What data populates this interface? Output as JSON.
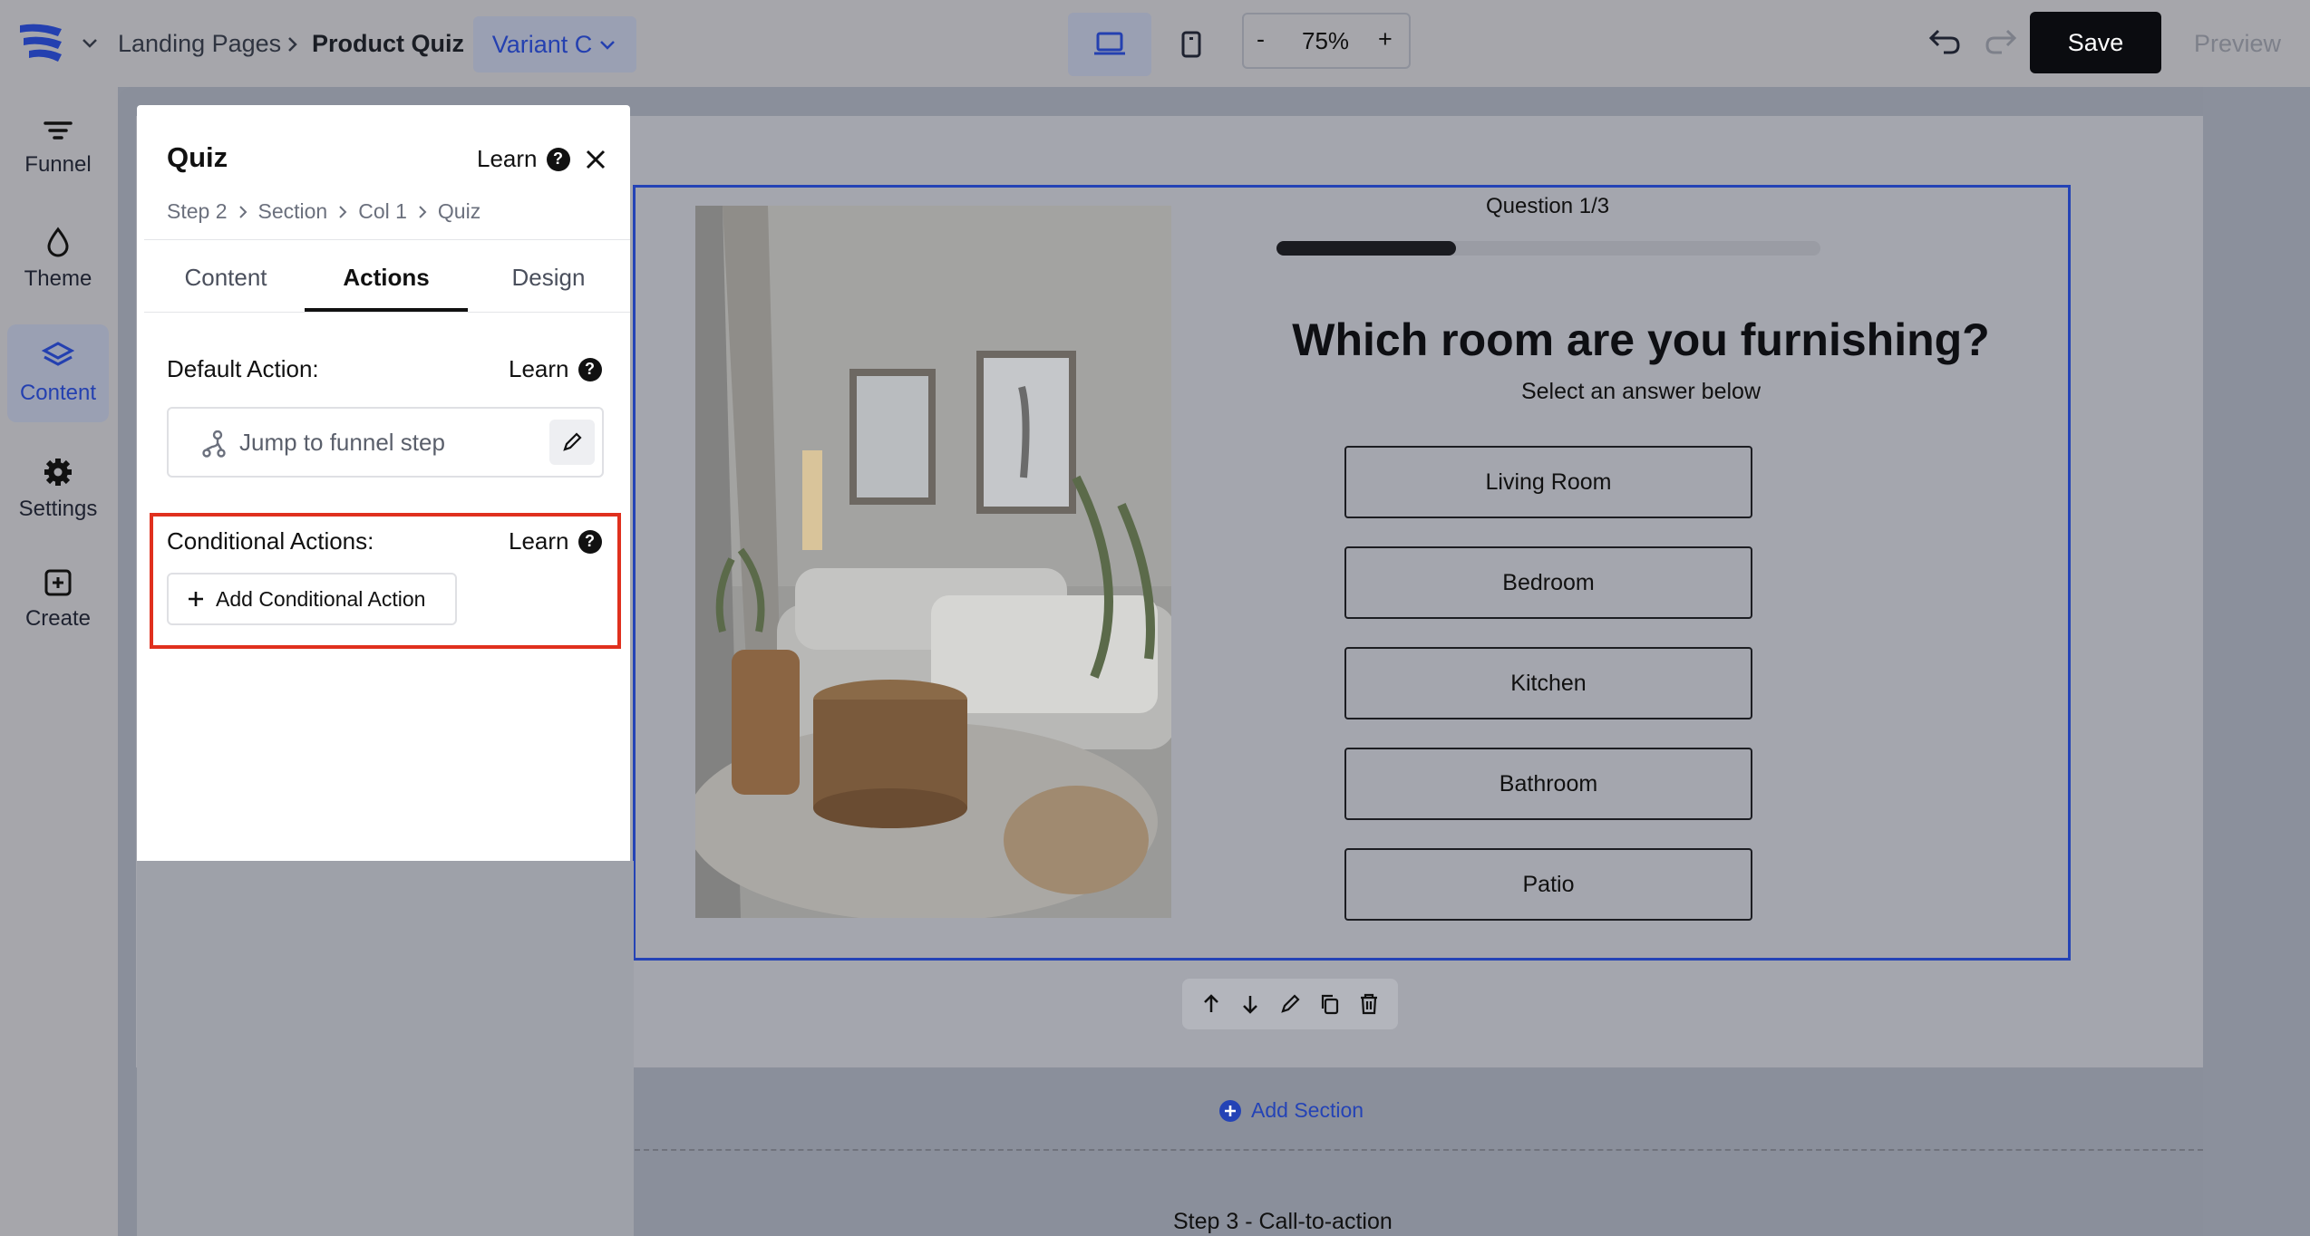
{
  "topbar": {
    "breadcrumb_parent": "Landing Pages",
    "breadcrumb_current": "Product Quiz",
    "variant_label": "Variant C",
    "zoom_minus": "-",
    "zoom_value": "75%",
    "zoom_plus": "+",
    "save_label": "Save",
    "preview_label": "Preview"
  },
  "rail": {
    "items": [
      {
        "label": "Funnel",
        "icon": "funnel-icon"
      },
      {
        "label": "Theme",
        "icon": "droplet-icon"
      },
      {
        "label": "Content",
        "icon": "layers-icon"
      },
      {
        "label": "Settings",
        "icon": "gear-icon"
      },
      {
        "label": "Create",
        "icon": "plus-square-icon"
      }
    ]
  },
  "panel": {
    "title": "Quiz",
    "learn": "Learn",
    "breadcrumb": [
      "Step 2",
      "Section",
      "Col 1",
      "Quiz"
    ],
    "tabs": [
      "Content",
      "Actions",
      "Design"
    ],
    "active_tab": "Actions",
    "default_action_label": "Default Action:",
    "default_action_learn": "Learn",
    "default_action_value": "Jump to funnel step",
    "conditional_label": "Conditional Actions:",
    "conditional_learn": "Learn",
    "add_conditional": "Add Conditional Action",
    "highlight_color": "#e0301e"
  },
  "quiz": {
    "progress_label": "Question 1/3",
    "progress_fraction": 0.33,
    "question": "Which room are you furnishing?",
    "subtitle": "Select an answer below",
    "answers": [
      "Living Room",
      "Bedroom",
      "Kitchen",
      "Bathroom",
      "Patio"
    ]
  },
  "canvas": {
    "add_section": "Add Section",
    "next_step": "Step 3 - Call-to-action"
  },
  "colors": {
    "accent": "#2443b6",
    "save_bg": "#0b0c10"
  }
}
